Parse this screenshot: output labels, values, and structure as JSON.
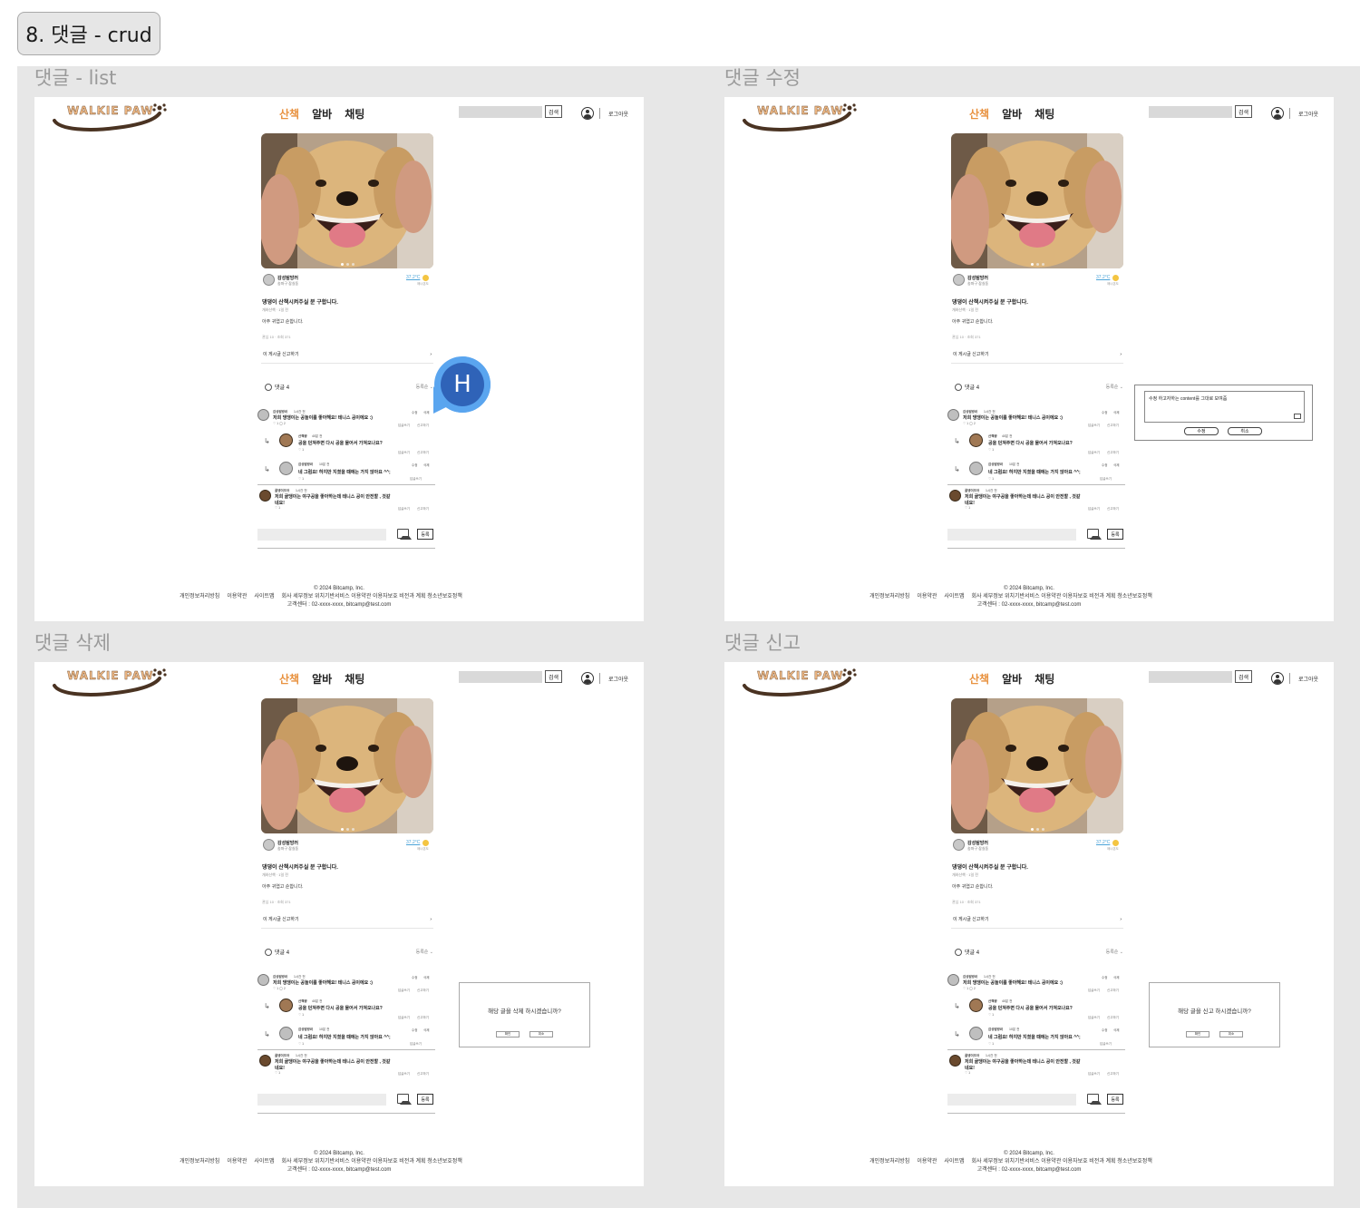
{
  "frame_title": "8. 댓글 - crud",
  "screens": [
    {
      "label": "댓글 - list",
      "overlay": "none"
    },
    {
      "label": "댓글 수정",
      "overlay": "edit"
    },
    {
      "label": "댓글 삭제",
      "overlay": "delete"
    },
    {
      "label": "댓글 신고",
      "overlay": "report"
    }
  ],
  "header": {
    "logo_text": "WALKIE PAW",
    "nav": [
      "산책",
      "알바",
      "채팅"
    ],
    "search_button": "검색",
    "logout": "로그아웃"
  },
  "post": {
    "author": "감성탐방러",
    "location": "송파구 잠실동",
    "temperature": "37.2°C",
    "temp_sub": "매너온도",
    "title": "댕댕이 산책시켜주실 분 구합니다.",
    "meta": "개와산책 · 1일 전",
    "body": "아주 귀엽고 순합니다.",
    "stats": "관심 10 · 조회 371",
    "report_link": "이 게시글 신고하기",
    "report_chevron": "›"
  },
  "comments_header": {
    "count_label": "댓글 4",
    "sort_label": "등록순"
  },
  "comments": [
    {
      "name": "감성탐방러",
      "time": "1시간 전",
      "text": "저희 댕댕이는 공놀이를 좋아해요! 테니스 공이에요 :)",
      "likes": "♡ 1   ◯ 2",
      "edit": "수정",
      "delete": "삭제",
      "reply": "답글쓰기",
      "report": "신고하기"
    },
    {
      "name": "산책왕",
      "time": "40분 전",
      "text": "공을 던져주면 다시 공을 물어서 가져오나요?",
      "likes": "♡ 1",
      "reply": "답글쓰기",
      "report": "신고하기"
    },
    {
      "name": "감성탐방러",
      "time": "10분 전",
      "text": "네 그럼요! 하지만 지쳤을 때에는 가지 않아요 ^^;",
      "likes": "♡ 1",
      "edit": "수정",
      "delete": "삭제",
      "reply": "답글쓰기"
    },
    {
      "name": "골댕이조아",
      "time": "1시간 전",
      "text": "저희 골댕이는 야구공을 좋아하는데 테니스 공이 안전할 , 것같네요!",
      "likes": "♡ 1",
      "reply": "답글쓰기",
      "report": "신고하기"
    }
  ],
  "comment_input": {
    "submit": "등록"
  },
  "footer": {
    "copyright": "© 2024 Bitcamp, Inc.",
    "links": [
      "개인정보처리방침",
      "이용약관",
      "사이트맵",
      "회사 세부정보 위치기반서비스 이용약관 이용자보호 비전과 계획 청소년보호정책"
    ],
    "contact": "고객센터 : 02-xxxx-xxxx, bitcamp@test.com"
  },
  "edit_dialog": {
    "placeholder": "수정 하고자하는 content를 그대로 보여줌",
    "confirm": "수정",
    "cancel": "취소"
  },
  "delete_dialog": {
    "message": "해당 글을 삭제 하시겠습니까?",
    "confirm": "확인",
    "cancel": "취소"
  },
  "report_dialog": {
    "message": "해당 글을 신고 하시겠습니까?",
    "confirm": "확인",
    "cancel": "취소"
  },
  "fab": {
    "letter": "H",
    "color": "#2f63b8"
  },
  "colors": {
    "accent": "#e8913e",
    "canvas": "#e7e7e7",
    "temp": "#4ba3d8"
  }
}
